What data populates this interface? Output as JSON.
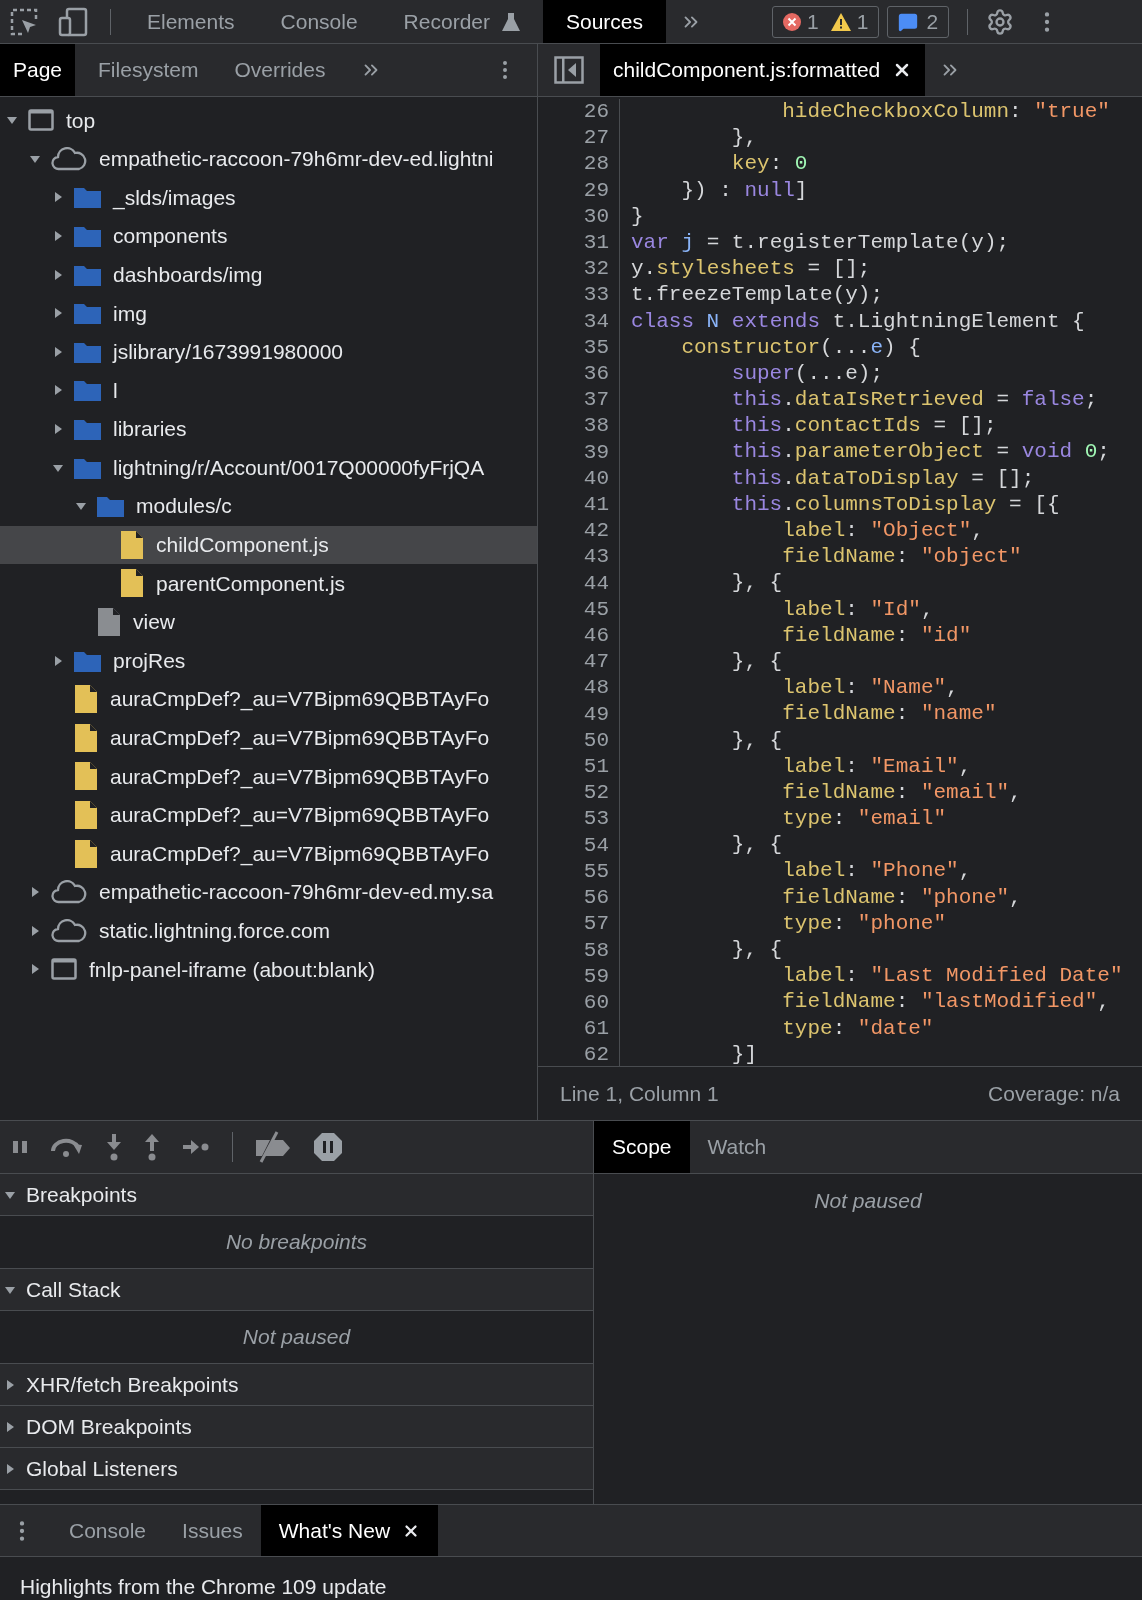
{
  "main_tabs": [
    {
      "label": "Elements",
      "kind": "plain",
      "selected": false
    },
    {
      "label": "Console",
      "kind": "plain",
      "selected": false
    },
    {
      "label": "Recorder",
      "kind": "experiment",
      "selected": false
    },
    {
      "label": "Sources",
      "kind": "plain",
      "selected": true
    }
  ],
  "counters": {
    "errors": "1",
    "warnings": "1",
    "messages": "2"
  },
  "navigator_tabs": [
    {
      "label": "Page",
      "selected": true
    },
    {
      "label": "Filesystem",
      "selected": false
    },
    {
      "label": "Overrides",
      "selected": false
    }
  ],
  "editor_tabs": [
    {
      "label": "childComponent.js:formatted",
      "selected": true
    }
  ],
  "tree": [
    {
      "label": "top",
      "kind": "frame",
      "expanded": true,
      "selected": false,
      "children": [
        {
          "label": "empathetic-raccoon-79h6mr-dev-ed.lightni",
          "kind": "cloud",
          "expanded": true,
          "selected": false,
          "children": [
            {
              "label": "_slds/images",
              "kind": "folder",
              "expanded": false,
              "selected": false
            },
            {
              "label": "components",
              "kind": "folder",
              "expanded": false,
              "selected": false
            },
            {
              "label": "dashboards/img",
              "kind": "folder",
              "expanded": false,
              "selected": false
            },
            {
              "label": "img",
              "kind": "folder",
              "expanded": false,
              "selected": false
            },
            {
              "label": "jslibrary/1673991980000",
              "kind": "folder",
              "expanded": false,
              "selected": false
            },
            {
              "label": "l",
              "kind": "folder",
              "expanded": false,
              "selected": false
            },
            {
              "label": "libraries",
              "kind": "folder",
              "expanded": false,
              "selected": false
            },
            {
              "label": "lightning/r/Account/0017Q00000fyFrjQA",
              "kind": "folder",
              "expanded": true,
              "selected": false,
              "children": [
                {
                  "label": "modules/c",
                  "kind": "folder",
                  "expanded": true,
                  "selected": false,
                  "children": [
                    {
                      "label": "childComponent.js",
                      "kind": "script",
                      "selected": true
                    },
                    {
                      "label": "parentComponent.js",
                      "kind": "script",
                      "selected": false
                    }
                  ]
                },
                {
                  "label": "view",
                  "kind": "document",
                  "selected": false
                }
              ]
            },
            {
              "label": "projRes",
              "kind": "folder",
              "expanded": false,
              "selected": false
            },
            {
              "label": "auraCmpDef?_au=V7Bipm69QBBTAyFo",
              "kind": "script",
              "selected": false
            },
            {
              "label": "auraCmpDef?_au=V7Bipm69QBBTAyFo",
              "kind": "script",
              "selected": false
            },
            {
              "label": "auraCmpDef?_au=V7Bipm69QBBTAyFo",
              "kind": "script",
              "selected": false
            },
            {
              "label": "auraCmpDef?_au=V7Bipm69QBBTAyFo",
              "kind": "script",
              "selected": false
            },
            {
              "label": "auraCmpDef?_au=V7Bipm69QBBTAyFo",
              "kind": "script",
              "selected": false
            }
          ]
        },
        {
          "label": "empathetic-raccoon-79h6mr-dev-ed.my.sa",
          "kind": "cloud",
          "expanded": false,
          "selected": false
        },
        {
          "label": "static.lightning.force.com",
          "kind": "cloud",
          "expanded": false,
          "selected": false
        },
        {
          "label": "fnlp-panel-iframe (about:blank)",
          "kind": "frame",
          "expanded": false,
          "selected": false
        }
      ]
    }
  ],
  "code_lines": [
    {
      "number": "26",
      "tokens": [
        {
          "text": "            hideCheckboxColumn",
          "kind": "prop"
        },
        {
          "text": ": ",
          "kind": "plain"
        },
        {
          "text": "\"true\"",
          "kind": "str"
        }
      ]
    },
    {
      "number": "27",
      "tokens": [
        {
          "text": "        },",
          "kind": "plain"
        }
      ]
    },
    {
      "number": "28",
      "tokens": [
        {
          "text": "        key",
          "kind": "prop"
        },
        {
          "text": ": ",
          "kind": "plain"
        },
        {
          "text": "0",
          "kind": "num"
        }
      ]
    },
    {
      "number": "29",
      "tokens": [
        {
          "text": "    }) : ",
          "kind": "plain"
        },
        {
          "text": "null",
          "kind": "kw"
        },
        {
          "text": "]",
          "kind": "plain"
        }
      ]
    },
    {
      "number": "30",
      "tokens": [
        {
          "text": "}",
          "kind": "plain"
        }
      ]
    },
    {
      "number": "31",
      "tokens": [
        {
          "text": "var",
          "kind": "kw"
        },
        {
          "text": " j",
          "kind": "def"
        },
        {
          "text": " = t.registerTemplate(y);",
          "kind": "plain"
        }
      ]
    },
    {
      "number": "32",
      "tokens": [
        {
          "text": "y.",
          "kind": "plain"
        },
        {
          "text": "stylesheets",
          "kind": "prop"
        },
        {
          "text": " = [];",
          "kind": "plain"
        }
      ]
    },
    {
      "number": "33",
      "tokens": [
        {
          "text": "t.freezeTemplate(y);",
          "kind": "plain"
        }
      ]
    },
    {
      "number": "34",
      "tokens": [
        {
          "text": "class",
          "kind": "kw"
        },
        {
          "text": " N",
          "kind": "def"
        },
        {
          "text": " extends",
          "kind": "kw"
        },
        {
          "text": " t.LightningElement {",
          "kind": "plain"
        }
      ]
    },
    {
      "number": "35",
      "tokens": [
        {
          "text": "    constructor",
          "kind": "prop"
        },
        {
          "text": "(...",
          "kind": "plain"
        },
        {
          "text": "e",
          "kind": "def"
        },
        {
          "text": ") {",
          "kind": "plain"
        }
      ]
    },
    {
      "number": "36",
      "tokens": [
        {
          "text": "        super",
          "kind": "kw"
        },
        {
          "text": "(...e);",
          "kind": "plain"
        }
      ]
    },
    {
      "number": "37",
      "tokens": [
        {
          "text": "        this",
          "kind": "kw"
        },
        {
          "text": ".",
          "kind": "plain"
        },
        {
          "text": "dataIsRetrieved",
          "kind": "prop"
        },
        {
          "text": " = ",
          "kind": "plain"
        },
        {
          "text": "false",
          "kind": "kw"
        },
        {
          "text": ";",
          "kind": "plain"
        }
      ]
    },
    {
      "number": "38",
      "tokens": [
        {
          "text": "        this",
          "kind": "kw"
        },
        {
          "text": ".",
          "kind": "plain"
        },
        {
          "text": "contactIds",
          "kind": "prop"
        },
        {
          "text": " = [];",
          "kind": "plain"
        }
      ]
    },
    {
      "number": "39",
      "tokens": [
        {
          "text": "        this",
          "kind": "kw"
        },
        {
          "text": ".",
          "kind": "plain"
        },
        {
          "text": "parameterObject",
          "kind": "prop"
        },
        {
          "text": " = ",
          "kind": "plain"
        },
        {
          "text": "void",
          "kind": "kw"
        },
        {
          "text": " 0",
          "kind": "num"
        },
        {
          "text": ";",
          "kind": "plain"
        }
      ]
    },
    {
      "number": "40",
      "tokens": [
        {
          "text": "        this",
          "kind": "kw"
        },
        {
          "text": ".",
          "kind": "plain"
        },
        {
          "text": "dataToDisplay",
          "kind": "prop"
        },
        {
          "text": " = [];",
          "kind": "plain"
        }
      ]
    },
    {
      "number": "41",
      "tokens": [
        {
          "text": "        this",
          "kind": "kw"
        },
        {
          "text": ".",
          "kind": "plain"
        },
        {
          "text": "columnsToDisplay",
          "kind": "prop"
        },
        {
          "text": " = [{",
          "kind": "plain"
        }
      ]
    },
    {
      "number": "42",
      "tokens": [
        {
          "text": "            label",
          "kind": "prop"
        },
        {
          "text": ": ",
          "kind": "plain"
        },
        {
          "text": "\"Object\"",
          "kind": "str"
        },
        {
          "text": ",",
          "kind": "plain"
        }
      ]
    },
    {
      "number": "43",
      "tokens": [
        {
          "text": "            fieldName",
          "kind": "prop"
        },
        {
          "text": ": ",
          "kind": "plain"
        },
        {
          "text": "\"object\"",
          "kind": "str"
        }
      ]
    },
    {
      "number": "44",
      "tokens": [
        {
          "text": "        }, {",
          "kind": "plain"
        }
      ]
    },
    {
      "number": "45",
      "tokens": [
        {
          "text": "            label",
          "kind": "prop"
        },
        {
          "text": ": ",
          "kind": "plain"
        },
        {
          "text": "\"Id\"",
          "kind": "str"
        },
        {
          "text": ",",
          "kind": "plain"
        }
      ]
    },
    {
      "number": "46",
      "tokens": [
        {
          "text": "            fieldName",
          "kind": "prop"
        },
        {
          "text": ": ",
          "kind": "plain"
        },
        {
          "text": "\"id\"",
          "kind": "str"
        }
      ]
    },
    {
      "number": "47",
      "tokens": [
        {
          "text": "        }, {",
          "kind": "plain"
        }
      ]
    },
    {
      "number": "48",
      "tokens": [
        {
          "text": "            label",
          "kind": "prop"
        },
        {
          "text": ": ",
          "kind": "plain"
        },
        {
          "text": "\"Name\"",
          "kind": "str"
        },
        {
          "text": ",",
          "kind": "plain"
        }
      ]
    },
    {
      "number": "49",
      "tokens": [
        {
          "text": "            fieldName",
          "kind": "prop"
        },
        {
          "text": ": ",
          "kind": "plain"
        },
        {
          "text": "\"name\"",
          "kind": "str"
        }
      ]
    },
    {
      "number": "50",
      "tokens": [
        {
          "text": "        }, {",
          "kind": "plain"
        }
      ]
    },
    {
      "number": "51",
      "tokens": [
        {
          "text": "            label",
          "kind": "prop"
        },
        {
          "text": ": ",
          "kind": "plain"
        },
        {
          "text": "\"Email\"",
          "kind": "str"
        },
        {
          "text": ",",
          "kind": "plain"
        }
      ]
    },
    {
      "number": "52",
      "tokens": [
        {
          "text": "            fieldName",
          "kind": "prop"
        },
        {
          "text": ": ",
          "kind": "plain"
        },
        {
          "text": "\"email\"",
          "kind": "str"
        },
        {
          "text": ",",
          "kind": "plain"
        }
      ]
    },
    {
      "number": "53",
      "tokens": [
        {
          "text": "            type",
          "kind": "prop"
        },
        {
          "text": ": ",
          "kind": "plain"
        },
        {
          "text": "\"email\"",
          "kind": "str"
        }
      ]
    },
    {
      "number": "54",
      "tokens": [
        {
          "text": "        }, {",
          "kind": "plain"
        }
      ]
    },
    {
      "number": "55",
      "tokens": [
        {
          "text": "            label",
          "kind": "prop"
        },
        {
          "text": ": ",
          "kind": "plain"
        },
        {
          "text": "\"Phone\"",
          "kind": "str"
        },
        {
          "text": ",",
          "kind": "plain"
        }
      ]
    },
    {
      "number": "56",
      "tokens": [
        {
          "text": "            fieldName",
          "kind": "prop"
        },
        {
          "text": ": ",
          "kind": "plain"
        },
        {
          "text": "\"phone\"",
          "kind": "str"
        },
        {
          "text": ",",
          "kind": "plain"
        }
      ]
    },
    {
      "number": "57",
      "tokens": [
        {
          "text": "            type",
          "kind": "prop"
        },
        {
          "text": ": ",
          "kind": "plain"
        },
        {
          "text": "\"phone\"",
          "kind": "str"
        }
      ]
    },
    {
      "number": "58",
      "tokens": [
        {
          "text": "        }, {",
          "kind": "plain"
        }
      ]
    },
    {
      "number": "59",
      "tokens": [
        {
          "text": "            label",
          "kind": "prop"
        },
        {
          "text": ": ",
          "kind": "plain"
        },
        {
          "text": "\"Last Modified Date\"",
          "kind": "str"
        }
      ]
    },
    {
      "number": "60",
      "tokens": [
        {
          "text": "            fieldName",
          "kind": "prop"
        },
        {
          "text": ": ",
          "kind": "plain"
        },
        {
          "text": "\"lastModified\"",
          "kind": "str"
        },
        {
          "text": ",",
          "kind": "plain"
        }
      ]
    },
    {
      "number": "61",
      "tokens": [
        {
          "text": "            type",
          "kind": "prop"
        },
        {
          "text": ": ",
          "kind": "plain"
        },
        {
          "text": "\"date\"",
          "kind": "str"
        }
      ]
    },
    {
      "number": "62",
      "tokens": [
        {
          "text": "        }]",
          "kind": "plain"
        }
      ]
    }
  ],
  "status": {
    "position": "Line 1, Column 1",
    "coverage": "Coverage: n/a"
  },
  "debugger": {
    "sections": [
      {
        "label": "Breakpoints",
        "expanded": true,
        "message": "No breakpoints"
      },
      {
        "label": "Call Stack",
        "expanded": true,
        "message": "Not paused"
      },
      {
        "label": "XHR/fetch Breakpoints",
        "expanded": false
      },
      {
        "label": "DOM Breakpoints",
        "expanded": false
      },
      {
        "label": "Global Listeners",
        "expanded": false
      }
    ],
    "side_tabs": [
      {
        "label": "Scope",
        "selected": true
      },
      {
        "label": "Watch",
        "selected": false
      }
    ],
    "side_message": "Not paused"
  },
  "drawer": {
    "tabs": [
      {
        "label": "Console",
        "selected": false,
        "closable": false
      },
      {
        "label": "Issues",
        "selected": false,
        "closable": false
      },
      {
        "label": "What's New",
        "selected": true,
        "closable": true
      }
    ],
    "content": "Highlights from the Chrome 109 update"
  }
}
